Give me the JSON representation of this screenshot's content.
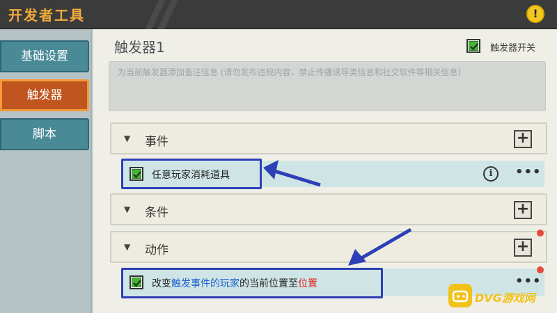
{
  "window": {
    "title": "开发者工具",
    "warning_glyph": "!"
  },
  "sidebar": {
    "items": [
      {
        "label": "基础设置",
        "active": false
      },
      {
        "label": "触发器",
        "active": true
      },
      {
        "label": "脚本",
        "active": false
      }
    ]
  },
  "trigger": {
    "name": "触发器1",
    "switch_label": "触发器开关",
    "switch_checked": true,
    "note_placeholder": "为当前触发器添加备注信息 (请勿发布违规内容，禁止传播诱导类信息和社交软件等相关信息)"
  },
  "sections": {
    "event": {
      "label": "事件",
      "caret": "▼",
      "add_glyph": "+",
      "items": [
        {
          "text": "任意玩家消耗道具",
          "checked": true
        }
      ]
    },
    "condition": {
      "label": "条件",
      "caret": "▼",
      "add_glyph": "+"
    },
    "action": {
      "label": "动作",
      "caret": "▼",
      "add_glyph": "+",
      "items": [
        {
          "checked": true,
          "parts": [
            {
              "text": "改变",
              "color": "#222222"
            },
            {
              "text": "触发事件的玩家",
              "color": "#1a5fd0"
            },
            {
              "text": "的当前位置至",
              "color": "#222222"
            },
            {
              "text": "位置",
              "color": "#e0222a"
            }
          ]
        }
      ]
    }
  },
  "icons": {
    "info": "i",
    "more": "•••"
  },
  "watermark": {
    "text": "DVG游戏网"
  },
  "colors": {
    "accent_orange": "#c1551f",
    "highlight_blue": "#2d3fb6",
    "check_green": "#4bb23e"
  }
}
